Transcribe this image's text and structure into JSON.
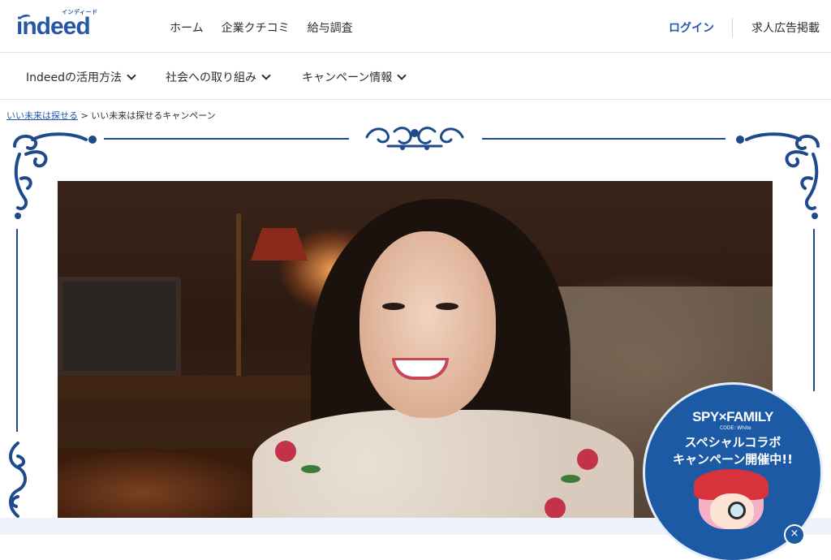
{
  "header": {
    "logo_ruby": "インディード",
    "logo_text": "indeed",
    "nav": [
      "ホーム",
      "企業クチコミ",
      "給与調査"
    ],
    "login": "ログイン",
    "employer": "求人広告掲載"
  },
  "subnav": {
    "items": [
      "Indeedの活用方法",
      "社会への取り組み",
      "キャンペーン情報"
    ]
  },
  "breadcrumb": {
    "link": "いい未来は探せる",
    "separator": ">",
    "current": "いい未来は探せるキャンペーン"
  },
  "badge": {
    "logo": "SPY×FAMILY",
    "logo_sub": "CODE: White",
    "line1": "スペシャルコラボ",
    "line2": "キャンペーン開催中!!",
    "close": "×"
  },
  "colors": {
    "brand": "#2557a7",
    "frame": "#1e4a8c",
    "badge": "#1d5aa6"
  },
  "icons": {
    "chevron": "chevron-down-icon",
    "close": "close-icon"
  }
}
